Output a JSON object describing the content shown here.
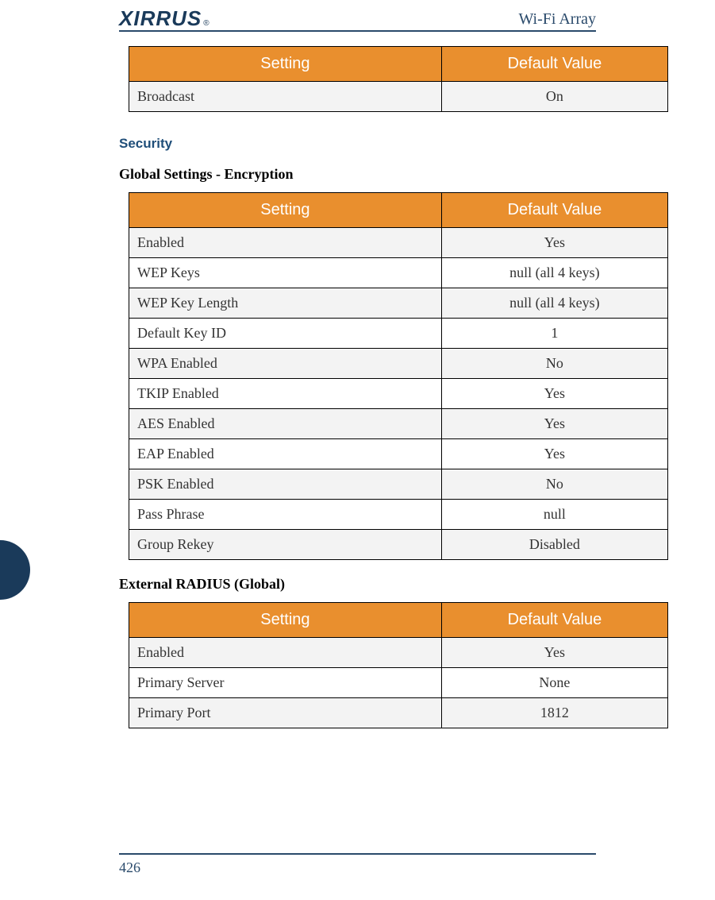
{
  "header": {
    "logo_text": "XIRRUS",
    "title": "Wi-Fi Array"
  },
  "page_number": "426",
  "sections": {
    "top_table": {
      "columns": [
        "Setting",
        "Default Value"
      ],
      "rows": [
        {
          "setting": "Broadcast",
          "value": "On"
        }
      ]
    },
    "security_label": "Security",
    "encryption": {
      "label": "Global Settings - Encryption",
      "columns": [
        "Setting",
        "Default Value"
      ],
      "rows": [
        {
          "setting": "Enabled",
          "value": "Yes"
        },
        {
          "setting": "WEP Keys",
          "value": "null (all 4 keys)"
        },
        {
          "setting": "WEP Key Length",
          "value": "null (all 4 keys)"
        },
        {
          "setting": "Default Key ID",
          "value": "1"
        },
        {
          "setting": "WPA Enabled",
          "value": "No"
        },
        {
          "setting": "TKIP Enabled",
          "value": "Yes"
        },
        {
          "setting": "AES Enabled",
          "value": "Yes"
        },
        {
          "setting": "EAP Enabled",
          "value": "Yes"
        },
        {
          "setting": "PSK Enabled",
          "value": "No"
        },
        {
          "setting": "Pass Phrase",
          "value": "null"
        },
        {
          "setting": "Group Rekey",
          "value": "Disabled"
        }
      ]
    },
    "radius": {
      "label": "External RADIUS (Global)",
      "columns": [
        "Setting",
        "Default Value"
      ],
      "rows": [
        {
          "setting": "Enabled",
          "value": "Yes"
        },
        {
          "setting": "Primary Server",
          "value": "None"
        },
        {
          "setting": "Primary Port",
          "value": "1812"
        }
      ]
    }
  }
}
